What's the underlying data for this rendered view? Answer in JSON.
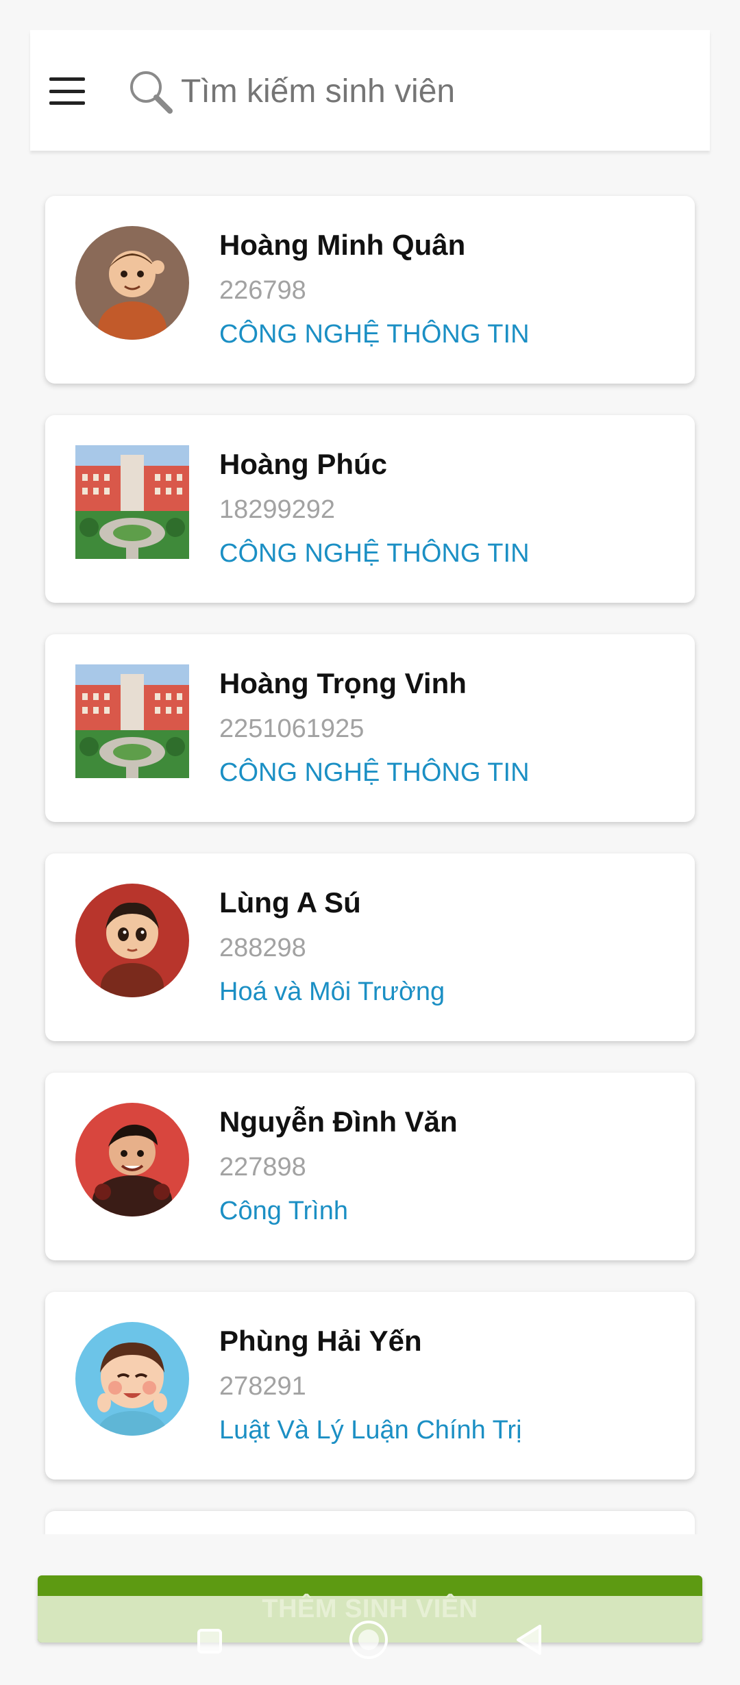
{
  "search": {
    "placeholder": "Tìm kiếm sinh viên"
  },
  "students": [
    {
      "name": "Hoàng Minh Quân",
      "id": "226798",
      "major": "CÔNG NGHỆ THÔNG TIN",
      "avatar": "cartoon-boy-avatar"
    },
    {
      "name": "Hoàng Phúc",
      "id": "18299292",
      "major": "CÔNG NGHỆ THÔNG TIN",
      "avatar": "university-building-photo"
    },
    {
      "name": "Hoàng Trọng Vinh",
      "id": "2251061925",
      "major": "CÔNG NGHỆ THÔNG TIN",
      "avatar": "university-building-photo"
    },
    {
      "name": "Lùng A Sú",
      "id": "288298",
      "major": "Hoá và Môi Trường",
      "avatar": "cartoon-boy-avatar"
    },
    {
      "name": "Nguyễn Đình Văn",
      "id": "227898",
      "major": "Công Trình",
      "avatar": "cartoon-warrior-avatar"
    },
    {
      "name": "Phùng Hải Yến",
      "id": "278291",
      "major": "Luật Và Lý Luận Chính Trị",
      "avatar": "smiling-baby-avatar"
    }
  ],
  "add_button": {
    "label": "THÊM SINH VIÊN"
  },
  "colors": {
    "accent_green": "#5d9a12",
    "major_blue": "#1b8fc4",
    "id_gray": "#a2a2a2"
  }
}
